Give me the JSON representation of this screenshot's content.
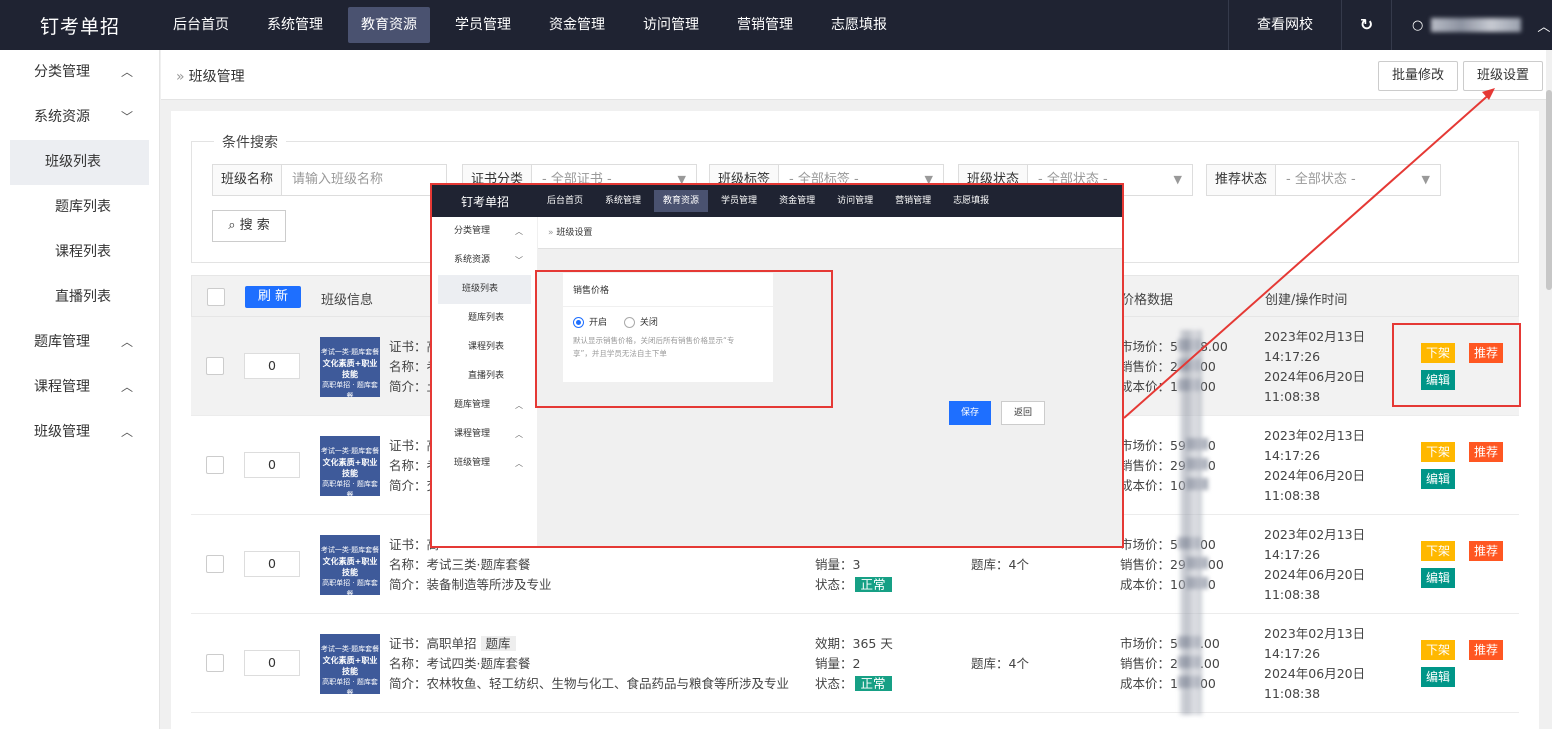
{
  "brand": "钉考单招",
  "nav": [
    "后台首页",
    "系统管理",
    "教育资源",
    "学员管理",
    "资金管理",
    "访问管理",
    "营销管理",
    "志愿填报"
  ],
  "nav_active_index": 2,
  "header_right": {
    "view_school": "查看网校"
  },
  "sidebar": {
    "groups": [
      {
        "label": "分类管理"
      },
      {
        "label": "系统资源"
      },
      {
        "label": "题库管理"
      },
      {
        "label": "课程管理"
      },
      {
        "label": "班级管理"
      }
    ],
    "sub_items": [
      "班级列表",
      "题库列表",
      "课程列表",
      "直播列表"
    ],
    "active_sub": "班级列表"
  },
  "breadcrumb": "班级管理",
  "top_buttons": {
    "batch_edit": "批量修改",
    "class_settings": "班级设置"
  },
  "search": {
    "legend": "条件搜索",
    "class_name_label": "班级名称",
    "class_name_placeholder": "请输入班级名称",
    "cert_label": "证书分类",
    "cert_value": "- 全部证书 -",
    "tag_label": "班级标签",
    "tag_value": "- 全部标签 -",
    "status_label": "班级状态",
    "status_value": "- 全部状态 -",
    "recommend_label": "推荐状态",
    "recommend_value": "- 全部状态 -",
    "search_button": "搜 索"
  },
  "table": {
    "refresh": "刷 新",
    "col_info": "班级信息",
    "col_price": "价格数据",
    "col_time": "创建/操作时间"
  },
  "thumb_text": {
    "line1": "考试一类·题库套餐",
    "line2": "文化素质+职业技能",
    "line3": "高职单招 · 题库套餐"
  },
  "rows": [
    {
      "order": "0",
      "cert": "证书：高",
      "name": "名称：考",
      "intro": "简介：土",
      "market": "市场价：5",
      "market_end": "8.00",
      "sale": "销售价：2",
      "sale_end": "00",
      "cost": "成本价：1",
      "cost_end": "00",
      "created": "2023年02月13日",
      "created_time": "14:17:26",
      "updated": "2024年06月20日",
      "updated_time": "11:08:38"
    },
    {
      "order": "0",
      "cert": "证书：高",
      "name": "名称：考",
      "intro": "简介：交",
      "market": "市场价：59",
      "market_end": "0",
      "sale": "销售价：29",
      "sale_end": "0",
      "cost": "成本价：10",
      "cost_end": "",
      "created": "2023年02月13日",
      "created_time": "14:17:26",
      "updated": "2024年06月20日",
      "updated_time": "11:08:38"
    },
    {
      "order": "0",
      "cert": "证书：高",
      "name": "名称：考试三类·题库套餐",
      "intro": "简介：装备制造等所涉及专业",
      "sales": "销量：3",
      "status": "状态：",
      "status_tag": "正常",
      "bank": "题库：4个",
      "market": "市场价：5",
      "market_end": "00",
      "sale": "销售价：29",
      "sale_end": "00",
      "cost": "成本价：10",
      "cost_end": "0",
      "created": "2023年02月13日",
      "created_time": "14:17:26",
      "updated": "2024年06月20日",
      "updated_time": "11:08:38"
    },
    {
      "order": "0",
      "cert": "证书：高职单招",
      "cert_tag": "题库",
      "name": "名称：考试四类·题库套餐",
      "intro": "简介：农林牧鱼、轻工纺织、生物与化工、食品药品与粮食等所涉及专业",
      "validity": "效期：365 天",
      "sales": "销量：2",
      "status": "状态：",
      "status_tag": "正常",
      "bank": "题库：4个",
      "market": "市场价：5",
      "market_end": ".00",
      "sale": "销售价：2",
      "sale_end": ".00",
      "cost": "成本价：1",
      "cost_end": "00",
      "created": "2023年02月13日",
      "created_time": "14:17:26",
      "updated": "2024年06月20日",
      "updated_time": "11:08:38"
    }
  ],
  "row_actions": {
    "off_shelf": "下架",
    "recommend": "推荐",
    "edit": "编辑"
  },
  "overlay": {
    "brand": "钉考单招",
    "nav": [
      "后台首页",
      "系统管理",
      "教育资源",
      "学员管理",
      "资金管理",
      "访问管理",
      "营销管理",
      "志愿填报"
    ],
    "sidebar_groups": [
      "分类管理",
      "系统资源",
      "题库管理",
      "课程管理",
      "班级管理"
    ],
    "sidebar_subs": [
      "班级列表",
      "题库列表",
      "课程列表",
      "直播列表"
    ],
    "breadcrumb": "班级设置",
    "card_title": "销售价格",
    "radio_on": "开启",
    "radio_off": "关闭",
    "desc_line1": "默认显示销售价格，关闭后所有销售价格显示“专",
    "desc_line2": "享”，并且学员无法自主下单",
    "save": "保存",
    "back": "返回"
  },
  "colors": {
    "topbar": "#1f2332",
    "primary": "#1e6fff",
    "annotation": "#e53935",
    "orange": "#ffb800",
    "red": "#ff5722",
    "teal": "#009688"
  }
}
